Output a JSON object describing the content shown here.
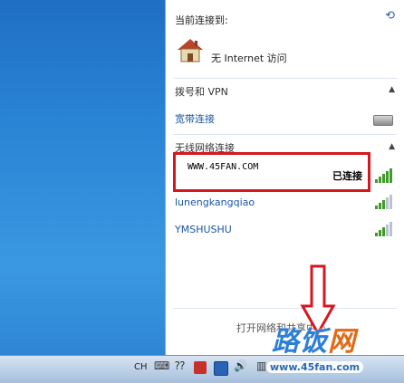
{
  "flyout": {
    "header": "当前连接到:",
    "status": "无 Internet 访问",
    "dialup_section": "拨号和 VPN",
    "broadband": "宽带连接",
    "wireless_section": "无线网络连接",
    "connected_network": {
      "name": "WWW.45FAN.COM",
      "status": "已连接",
      "signal": 5
    },
    "networks": [
      {
        "name": "lunengkangqiao",
        "signal": 3
      },
      {
        "name": "YMSHUSHU",
        "signal": 3
      }
    ],
    "footer_link": "打开网络和共享中心"
  },
  "taskbar": {
    "language": "CH"
  },
  "watermark": {
    "logo_main": "路饭",
    "logo_accent": "网",
    "url": "www.45fan.com"
  },
  "colors": {
    "highlight": "#d7171f",
    "link": "#1a56a6",
    "signal": "#3f9b2a"
  }
}
